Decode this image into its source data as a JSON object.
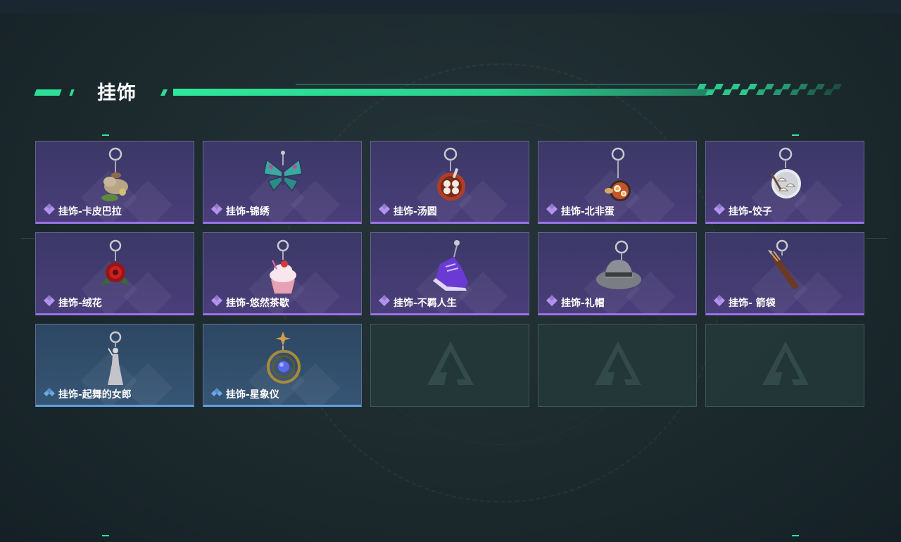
{
  "section": {
    "title": "挂饰"
  },
  "colors": {
    "accent": "#2ee89a",
    "purple_rarity": "#9a73e6",
    "blue_rarity": "#5fa0e0"
  },
  "items": [
    {
      "label": "挂饰-卡皮巴拉",
      "rarity": "purple",
      "icon": "capybara-charm-icon"
    },
    {
      "label": "挂饰-锦绣",
      "rarity": "purple",
      "icon": "butterfly-charm-icon"
    },
    {
      "label": "挂饰-汤圆",
      "rarity": "purple",
      "icon": "tangyuan-bowl-charm-icon"
    },
    {
      "label": "挂饰-北非蛋",
      "rarity": "purple",
      "icon": "shakshuka-charm-icon"
    },
    {
      "label": "挂饰-饺子",
      "rarity": "purple",
      "icon": "dumpling-plate-charm-icon"
    },
    {
      "label": "挂饰-绒花",
      "rarity": "purple",
      "icon": "velvet-flower-charm-icon"
    },
    {
      "label": "挂饰-悠然茶歇",
      "rarity": "purple",
      "icon": "cupcake-charm-icon"
    },
    {
      "label": "挂饰-不羁人生",
      "rarity": "purple",
      "icon": "sneaker-charm-icon"
    },
    {
      "label": "挂饰-礼帽",
      "rarity": "purple",
      "icon": "fedora-hat-charm-icon"
    },
    {
      "label": "挂饰- 箭袋",
      "rarity": "purple",
      "icon": "quiver-charm-icon"
    },
    {
      "label": "挂饰-起舞的女郎",
      "rarity": "blue",
      "icon": "dancing-lady-charm-icon"
    },
    {
      "label": "挂饰-星象仪",
      "rarity": "blue",
      "icon": "astrolabe-charm-icon"
    }
  ],
  "empty_slots": [
    {
      "icon": "empty-slot-logo-icon"
    },
    {
      "icon": "empty-slot-logo-icon"
    },
    {
      "icon": "empty-slot-logo-icon"
    }
  ]
}
